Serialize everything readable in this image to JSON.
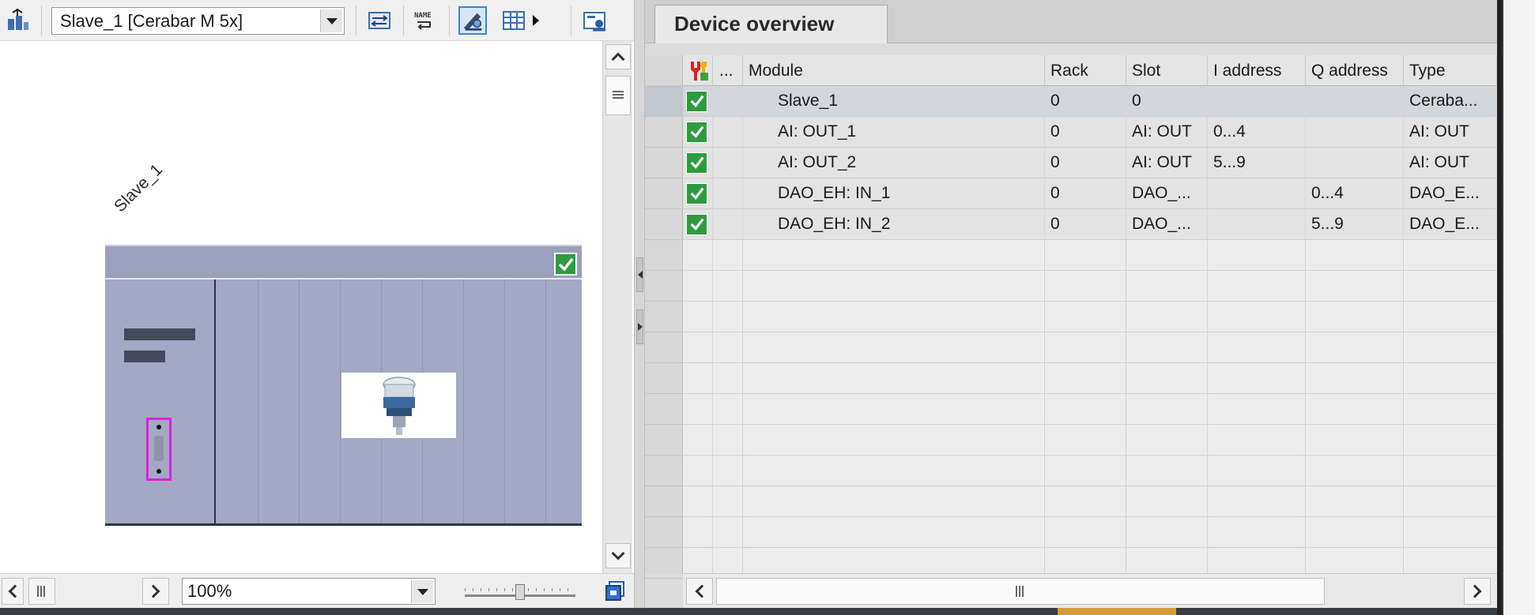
{
  "toolbar": {
    "device_select": "Slave_1 [Cerabar M 5x]",
    "icons": [
      "network-view-icon",
      "swap-icon",
      "name-icon",
      "show-module-labels-icon",
      "grid-icon",
      "more-arrow-icon",
      "device-properties-icon"
    ]
  },
  "canvas": {
    "device_label": "Slave_1",
    "zoom": "100%"
  },
  "device_overview": {
    "tab_label": "Device overview",
    "columns": [
      "",
      "...",
      "Module",
      "Rack",
      "Slot",
      "I address",
      "Q address",
      "Type"
    ],
    "rows": [
      {
        "module": "Slave_1",
        "rack": "0",
        "slot": "0",
        "i_address": "",
        "q_address": "",
        "type": "Ceraba..."
      },
      {
        "module": "AI: OUT_1",
        "rack": "0",
        "slot": "AI: OUT",
        "i_address": "0...4",
        "q_address": "",
        "type": "AI: OUT"
      },
      {
        "module": "AI: OUT_2",
        "rack": "0",
        "slot": "AI: OUT",
        "i_address": "5...9",
        "q_address": "",
        "type": "AI: OUT"
      },
      {
        "module": "DAO_EH: IN_1",
        "rack": "0",
        "slot": "DAO_...",
        "i_address": "",
        "q_address": "0...4",
        "type": "DAO_E..."
      },
      {
        "module": "DAO_EH: IN_2",
        "rack": "0",
        "slot": "DAO_...",
        "i_address": "",
        "q_address": "5...9",
        "type": "DAO_E..."
      }
    ]
  },
  "colors": {
    "ok_green": "#2e9b3e",
    "rack_bg": "#a3a8c4",
    "port_highlight": "#e11ee0"
  }
}
